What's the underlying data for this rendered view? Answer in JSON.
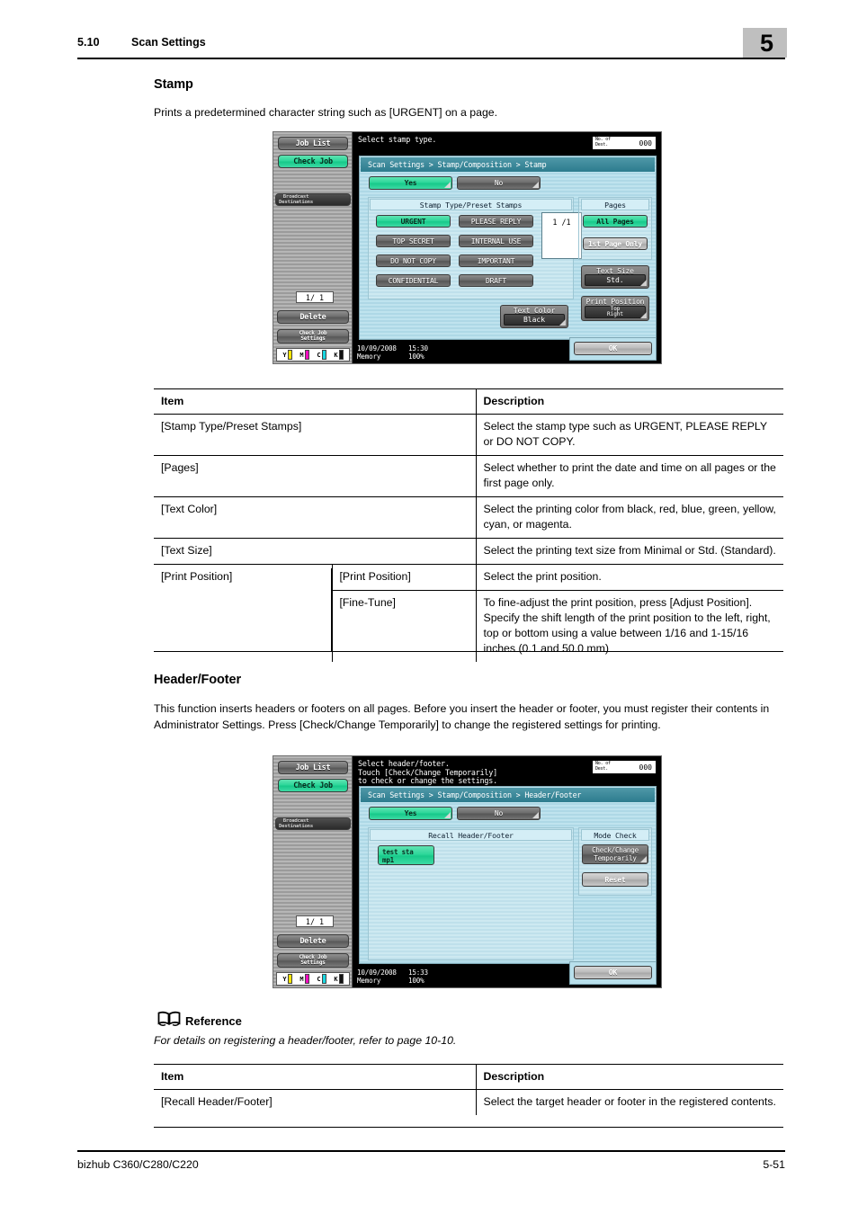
{
  "header": {
    "section_number": "5.10",
    "section_title": "Scan Settings",
    "chapter": "5"
  },
  "stamp_section": {
    "title": "Stamp",
    "intro": "Prints a predetermined character string such as [URGENT] on a page."
  },
  "stamp_screen": {
    "message": "Select stamp type.",
    "dest_label": "No. of\nDest.",
    "dest_value": "000",
    "breadcrumb": "Scan Settings > Stamp/Composition > Stamp",
    "yes_label": "Yes",
    "no_label": "No",
    "group_title": "Stamp Type/Preset Stamps",
    "stamps": [
      "URGENT",
      "PLEASE REPLY",
      "TOP SECRET",
      "INTERNAL USE",
      "DO NOT COPY",
      "IMPORTANT",
      "CONFIDENTIAL",
      "DRAFT"
    ],
    "page_counter": "1  /1",
    "pages_title": "Pages",
    "all_pages_label": "All Pages",
    "first_page_label": "1st Page Only",
    "text_size_caption": "Text Size",
    "text_size_value": "Std.",
    "print_position_caption": "Print Position",
    "print_position_value": "Top\nRight",
    "text_color_caption": "Text Color",
    "text_color_value": "Black",
    "ok_label": "OK",
    "status_date": "10/09/2008",
    "status_time": "15:30",
    "status_memory": "Memory",
    "status_memory_value": "100%"
  },
  "rail": {
    "job_list": "Job List",
    "check_job": "Check Job",
    "broadcast": "Broadcast\nDestinations",
    "page_counter": "1/  1",
    "delete": "Delete",
    "check_job_settings": "Check Job\nSettings",
    "toner": [
      "Y",
      "M",
      "C",
      "K"
    ]
  },
  "stamp_table": {
    "col_item": "Item",
    "col_description": "Description",
    "rows": [
      {
        "item": "[Stamp Type/Preset Stamps]",
        "sub": "",
        "desc": "Select the stamp type such as URGENT, PLEASE REPLY or DO NOT COPY."
      },
      {
        "item": "[Pages]",
        "sub": "",
        "desc": "Select whether to print the date and time on all pages or the first page only."
      },
      {
        "item": "[Text Color]",
        "sub": "",
        "desc": "Select the printing color from black, red, blue, green, yellow, cyan, or magenta."
      },
      {
        "item": "[Text Size]",
        "sub": "",
        "desc": "Select the printing text size from Minimal or Std. (Standard)."
      },
      {
        "item": "[Print Position]",
        "sub": "[Print Position]",
        "desc": "Select the print position."
      },
      {
        "item": "",
        "sub": "[Fine-Tune]",
        "desc": "To fine-adjust the print position, press [Adjust Position]. Specify the shift length of the print position to the left, right, top or bottom using a value between 1/16 and 1-15/16 inches (0.1 and 50.0 mm)"
      }
    ]
  },
  "headerfooter_section": {
    "title": "Header/Footer",
    "intro": "This function inserts headers or footers on all pages. Before you insert the header or footer, you must register their contents in Administrator Settings. Press [Check/Change Temporarily] to change the registered settings for printing."
  },
  "headerfooter_screen": {
    "message": "Select header/footer.\nTouch [Check/Change Temporarily]\nto check or change the settings.",
    "dest_label": "No. of\nDest.",
    "dest_value": "000",
    "breadcrumb": "Scan Settings > Stamp/Composition > Header/Footer",
    "yes_label": "Yes",
    "no_label": "No",
    "group_title": "Recall Header/Footer",
    "recall_item": "test sta\nmp1",
    "mode_check_title": "Mode Check",
    "check_change_label": "Check/Change\nTemporarily",
    "reset_label": "Reset",
    "ok_label": "OK",
    "status_date": "10/09/2008",
    "status_time": "15:33",
    "status_memory": "Memory",
    "status_memory_value": "100%"
  },
  "reference": {
    "title": "Reference",
    "text": "For details on registering a header/footer, refer to page 10-10."
  },
  "headerfooter_table": {
    "col_item": "Item",
    "col_description": "Description",
    "rows": [
      {
        "item": "[Recall Header/Footer]",
        "desc": "Select the target header or footer in the registered contents."
      }
    ]
  },
  "footer": {
    "left": "bizhub C360/C280/C220",
    "right": "5-51"
  },
  "colors": {
    "accent_green": "#2ed79a",
    "breadcrumb_teal": "#2d7c8e",
    "panel_blue": "#aed8e6",
    "chapter_gray": "#bfbfbf"
  }
}
